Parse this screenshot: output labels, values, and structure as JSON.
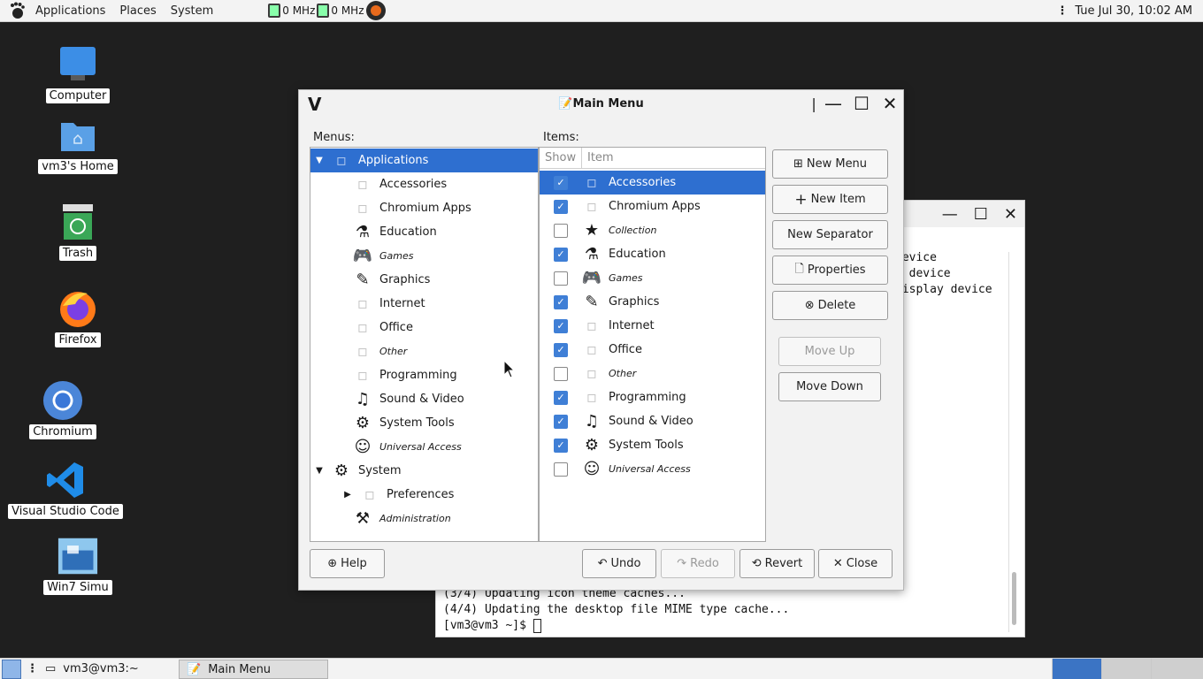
{
  "top_panel": {
    "menus": [
      "Applications",
      "Places",
      "System"
    ],
    "cpu1": "0 MHz",
    "cpu2": "0 MHz",
    "clock": "Tue Jul 30, 10:02 AM"
  },
  "desktop": {
    "icons": [
      {
        "label": "Computer",
        "icon": "computer-icon"
      },
      {
        "label": "vm3's Home",
        "icon": "home-folder-icon"
      },
      {
        "label": "Trash",
        "icon": "trash-icon"
      },
      {
        "label": "Firefox",
        "icon": "firefox-icon"
      },
      {
        "label": "Chromium",
        "icon": "chromium-icon"
      },
      {
        "label": "Visual Studio Code",
        "icon": "vscode-icon"
      },
      {
        "label": "Win7 Simu",
        "icon": "win7-icon"
      }
    ]
  },
  "terminal": {
    "lines": [
      "device",
      "y device",
      "display device"
    ],
    "bottom_lines": [
      "(3/4) Updating icon theme caches...",
      "(4/4) Updating the desktop file MIME type cache...",
      "[vm3@vm3 ~]$ "
    ]
  },
  "dialog": {
    "title": "Main Menu",
    "menus_label": "Menus:",
    "items_label": "Items:",
    "menu_tree": [
      {
        "label": "Applications",
        "icon": "applications-icon",
        "selected": true,
        "expander": "down"
      },
      {
        "label": "Accessories",
        "icon": "accessories-icon"
      },
      {
        "label": "Chromium Apps",
        "icon": "chromium-apps-icon"
      },
      {
        "label": "Education",
        "icon": "flask-icon"
      },
      {
        "label": "Games",
        "icon": "gamepad-icon",
        "italic": true
      },
      {
        "label": "Graphics",
        "icon": "graphics-icon"
      },
      {
        "label": "Internet",
        "icon": "internet-icon"
      },
      {
        "label": "Office",
        "icon": "office-icon"
      },
      {
        "label": "Other",
        "icon": "other-icon",
        "italic": true
      },
      {
        "label": "Programming",
        "icon": "programming-icon"
      },
      {
        "label": "Sound & Video",
        "icon": "film-music-icon"
      },
      {
        "label": "System Tools",
        "icon": "gear-icon"
      },
      {
        "label": "Universal Access",
        "icon": "accessibility-icon",
        "italic": true
      },
      {
        "label": "System",
        "icon": "system-icon",
        "expander": "down"
      },
      {
        "label": "Preferences",
        "icon": "preferences-icon",
        "expander": "right"
      },
      {
        "label": "Administration",
        "icon": "tools-icon",
        "italic": true
      }
    ],
    "items_header": {
      "show": "Show",
      "item": "Item"
    },
    "items": [
      {
        "label": "Accessories",
        "icon": "accessories-icon",
        "show": true,
        "selected": true
      },
      {
        "label": "Chromium Apps",
        "icon": "chromium-apps-icon",
        "show": true
      },
      {
        "label": "Collection",
        "icon": "star-icon",
        "show": false,
        "italic": true
      },
      {
        "label": "Education",
        "icon": "flask-icon",
        "show": true
      },
      {
        "label": "Games",
        "icon": "gamepad-icon",
        "show": false,
        "italic": true
      },
      {
        "label": "Graphics",
        "icon": "graphics-icon",
        "show": true
      },
      {
        "label": "Internet",
        "icon": "internet-icon",
        "show": true
      },
      {
        "label": "Office",
        "icon": "office-icon",
        "show": true
      },
      {
        "label": "Other",
        "icon": "other-icon",
        "show": false,
        "italic": true
      },
      {
        "label": "Programming",
        "icon": "programming-icon",
        "show": true
      },
      {
        "label": "Sound & Video",
        "icon": "film-music-icon",
        "show": true
      },
      {
        "label": "System Tools",
        "icon": "gear-icon",
        "show": true
      },
      {
        "label": "Universal Access",
        "icon": "accessibility-icon",
        "show": false,
        "italic": true
      }
    ],
    "buttons": {
      "new_menu": "New Menu",
      "new_item": "New Item",
      "new_separator": "New Separator",
      "properties": "Properties",
      "delete": "Delete",
      "move_up": "Move Up",
      "move_down": "Move Down",
      "help": "Help",
      "undo": "Undo",
      "redo": "Redo",
      "revert": "Revert",
      "close": "Close"
    }
  },
  "bottom_panel": {
    "task1": "vm3@vm3:~",
    "task2": "Main Menu"
  },
  "colors": {
    "selection": "#2e6fd0",
    "checkbox": "#3f7fd6"
  }
}
